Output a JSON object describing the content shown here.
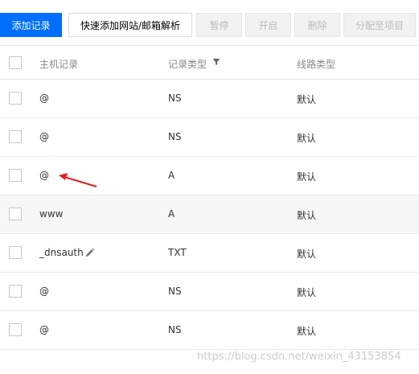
{
  "toolbar": {
    "add_record": "添加记录",
    "quick_add": "快速添加网站/邮箱解析",
    "pause": "暂停",
    "enable": "开启",
    "delete": "删除",
    "assign_project": "分配至项目"
  },
  "table": {
    "headers": {
      "host": "主机记录",
      "record_type": "记录类型",
      "line_type": "线路类型"
    },
    "rows": [
      {
        "host": "@",
        "type": "NS",
        "line": "默认"
      },
      {
        "host": "@",
        "type": "NS",
        "line": "默认"
      },
      {
        "host": "@",
        "type": "A",
        "line": "默认"
      },
      {
        "host": "www",
        "type": "A",
        "line": "默认"
      },
      {
        "host": "_dnsauth",
        "type": "TXT",
        "line": "默认"
      },
      {
        "host": "@",
        "type": "NS",
        "line": "默认"
      },
      {
        "host": "@",
        "type": "NS",
        "line": "默认"
      }
    ]
  },
  "annotation": {
    "arrow_color": "#e02020"
  },
  "watermark": "https://blog.csdn.net/weixin_43153854",
  "colors": {
    "primary": "#006eff",
    "row_highlight": "#f7f7f7"
  }
}
